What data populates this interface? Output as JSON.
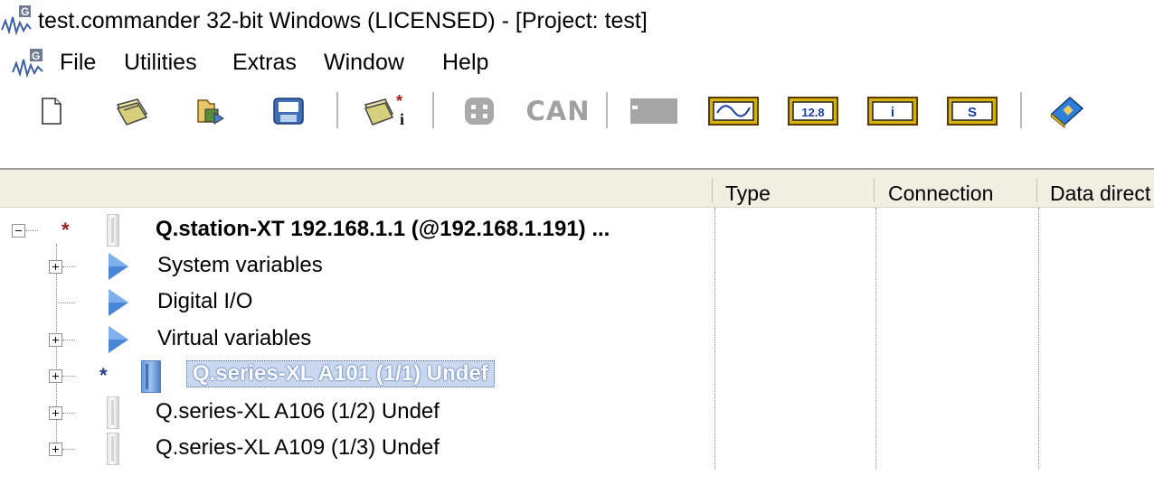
{
  "window": {
    "title": "test.commander 32-bit Windows  (LICENSED) - [Project: test]"
  },
  "menu": {
    "items": [
      "File",
      "Utilities",
      "Extras",
      "Window",
      "Help"
    ]
  },
  "toolbar": {
    "buttons": [
      {
        "name": "new-document-icon"
      },
      {
        "name": "open-project-icon"
      },
      {
        "name": "open-folder-icon"
      },
      {
        "name": "save-icon"
      },
      {
        "name": "configure-station-icon"
      },
      {
        "name": "modules-icon"
      },
      {
        "name": "can-icon",
        "label": "CAN"
      },
      {
        "name": "display-icon"
      },
      {
        "name": "scope-icon"
      },
      {
        "name": "numeric-display-icon",
        "label": "12.8"
      },
      {
        "name": "info-icon",
        "label": "i"
      },
      {
        "name": "script-icon",
        "label": "S"
      },
      {
        "name": "help-book-icon"
      }
    ]
  },
  "columns": [
    "Type",
    "Connection",
    "Data direct"
  ],
  "tree": {
    "root": {
      "label": "Q.station-XT 192.168.1.1 (@192.168.1.191) ...",
      "star_color": "#9a1c1c"
    },
    "children": [
      {
        "label": "System variables",
        "expander": "plus"
      },
      {
        "label": "Digital I/O",
        "expander": "none"
      },
      {
        "label": "Virtual variables",
        "expander": "plus"
      },
      {
        "label": "Q.series-XL A101 (1/1) Undef",
        "expander": "plus",
        "selected": true,
        "star_color": "#1f3f8a"
      },
      {
        "label": "Q.series-XL A106 (1/2) Undef",
        "expander": "plus"
      },
      {
        "label": "Q.series-XL A109 (1/3) Undef",
        "expander": "plus"
      }
    ]
  },
  "colors": {
    "header_bg": "#f1efe2",
    "selection_bg": "#c9d8ee",
    "arrow_blue": "#4a86d8"
  }
}
